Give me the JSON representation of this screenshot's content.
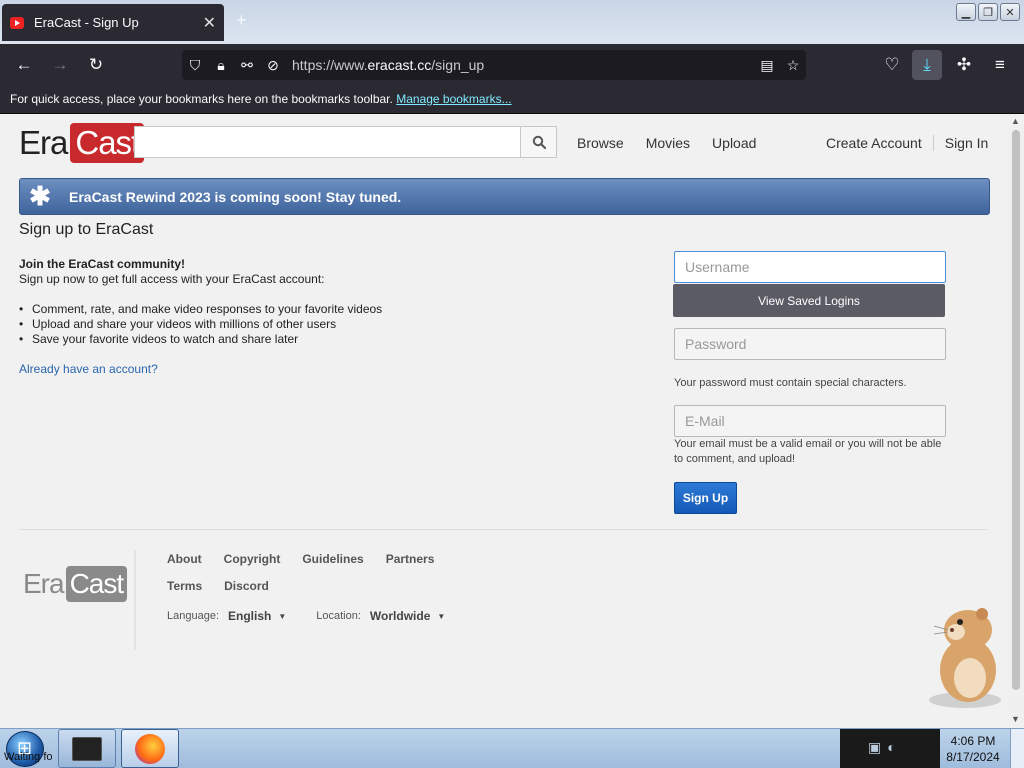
{
  "browser": {
    "tab_title": "EraCast - Sign Up",
    "tab_close": "✕",
    "new_tab": "+",
    "url_prefix": "https://www.",
    "url_domain": "eracast.cc",
    "url_path": "/sign_up",
    "bookmarks_text": "For quick access, place your bookmarks here on the bookmarks toolbar.",
    "bookmarks_link": "Manage bookmarks..."
  },
  "site": {
    "logo_era": "Era",
    "logo_cast": "Cast",
    "search_placeholder": "",
    "nav_left": [
      "Browse",
      "Movies",
      "Upload"
    ],
    "nav_right": [
      "Create Account",
      "Sign In"
    ],
    "banner_text": "EraCast Rewind 2023 is coming soon! Stay tuned."
  },
  "signup": {
    "title": "Sign up to EraCast",
    "join_heading": "Join the EraCast community!",
    "join_sub": "Sign up now to get full access with your EraCast account:",
    "benefits": [
      "Comment, rate, and make video responses to your favorite videos",
      "Upload and share your videos with millions of other users",
      "Save your favorite videos to watch and share later"
    ],
    "already_link": "Already have an account?",
    "username_placeholder": "Username",
    "saved_logins": "View Saved Logins",
    "password_placeholder": "Password",
    "password_hint": "Your password must contain special characters.",
    "email_placeholder": "E-Mail",
    "email_hint": "Your email must be a valid email or you will not be able to comment, and upload!",
    "submit": "Sign Up"
  },
  "footer": {
    "links_row1": [
      "About",
      "Copyright",
      "Guidelines",
      "Partners"
    ],
    "links_row2": [
      "Terms",
      "Discord"
    ],
    "language_label": "Language:",
    "language_value": "English",
    "location_label": "Location:",
    "location_value": "Worldwide"
  },
  "taskbar": {
    "start_text": "Waiting fo",
    "time": "4:06 PM",
    "date": "8/17/2024"
  },
  "icons": {
    "search": "search-icon",
    "star": "star-icon"
  }
}
